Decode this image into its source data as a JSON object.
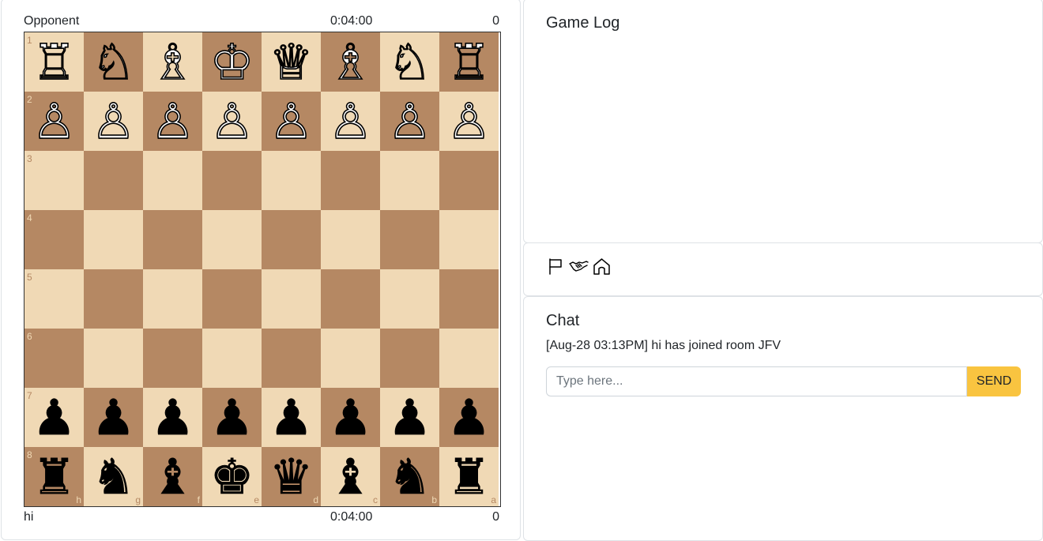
{
  "opponent": {
    "name": "Opponent",
    "clock": "0:04:00",
    "score": "0"
  },
  "player": {
    "name": "hi",
    "clock": "0:04:00",
    "score": "0"
  },
  "board": {
    "colors": {
      "light": "#f0d9b5",
      "dark": "#b58863"
    },
    "rank_labels": [
      "1",
      "2",
      "3",
      "4",
      "5",
      "6",
      "7",
      "8"
    ],
    "file_labels": [
      "h",
      "g",
      "f",
      "e",
      "d",
      "c",
      "b",
      "a"
    ],
    "rows": [
      [
        "♖",
        "♘",
        "♗",
        "♔",
        "♕",
        "♗",
        "♘",
        "♖"
      ],
      [
        "♙",
        "♙",
        "♙",
        "♙",
        "♙",
        "♙",
        "♙",
        "♙"
      ],
      [
        "",
        "",
        "",
        "",
        "",
        "",
        "",
        ""
      ],
      [
        "",
        "",
        "",
        "",
        "",
        "",
        "",
        ""
      ],
      [
        "",
        "",
        "",
        "",
        "",
        "",
        "",
        ""
      ],
      [
        "",
        "",
        "",
        "",
        "",
        "",
        "",
        ""
      ],
      [
        "♟",
        "♟",
        "♟",
        "♟",
        "♟",
        "♟",
        "♟",
        "♟"
      ],
      [
        "♜",
        "♞",
        "♝",
        "♚",
        "♛",
        "♝",
        "♞",
        "♜"
      ]
    ],
    "colors_by_row": [
      "w",
      "w",
      "",
      "",
      "",
      "",
      "b",
      "b"
    ]
  },
  "game_log": {
    "title": "Game Log"
  },
  "actions": {
    "icons": [
      "flag-icon",
      "handshake-icon",
      "house-icon"
    ]
  },
  "chat": {
    "title": "Chat",
    "messages": [
      "[Aug-28 03:13PM] hi has joined room JFV"
    ],
    "input_placeholder": "Type here...",
    "send_label": "SEND",
    "send_color": "#f9c440"
  }
}
